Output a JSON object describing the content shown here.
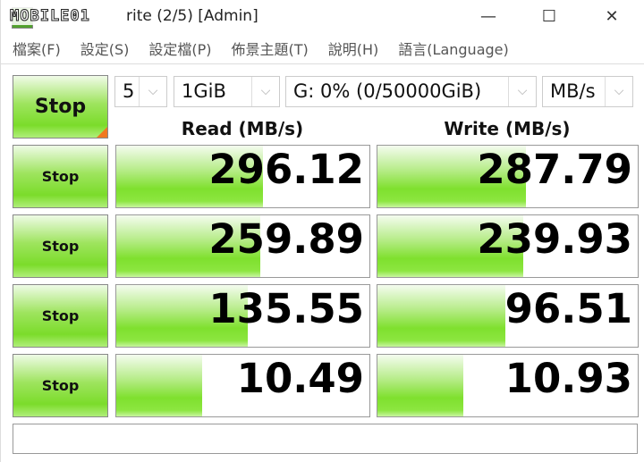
{
  "window": {
    "title": "rite (2/5) [Admin]",
    "watermark": "MOBILE01",
    "minimize": "—",
    "maximize": "☐",
    "close": "✕"
  },
  "menu": [
    "檔案(F)",
    "設定(S)",
    "設定檔(P)",
    "佈景主題(T)",
    "說明(H)",
    "語言(Language)"
  ],
  "controls": {
    "main_button": "Stop",
    "count": "5",
    "size": "1GiB",
    "drive": "G: 0% (0/50000GiB)",
    "unit": "MB/s"
  },
  "headers": {
    "read": "Read (MB/s)",
    "write": "Write (MB/s)"
  },
  "rows": [
    {
      "button": "Stop",
      "read": "296.12",
      "write": "287.79",
      "read_fill": 0.58,
      "write_fill": 0.57
    },
    {
      "button": "Stop",
      "read": "259.89",
      "write": "239.93",
      "read_fill": 0.57,
      "write_fill": 0.56
    },
    {
      "button": "Stop",
      "read": "135.55",
      "write": "96.51",
      "read_fill": 0.52,
      "write_fill": 0.49
    },
    {
      "button": "Stop",
      "read": "10.49",
      "write": "10.93",
      "read_fill": 0.34,
      "write_fill": 0.33
    }
  ],
  "status": ""
}
